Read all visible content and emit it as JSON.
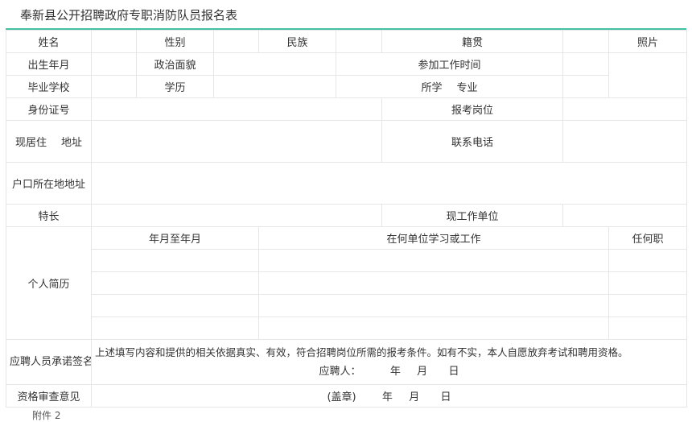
{
  "title": "奉新县公开招聘政府专职消防队员报名表",
  "accent_color": "#45c2a6",
  "row1": {
    "name": "姓名",
    "gender": "性别",
    "ethnicity": "民族",
    "native_place": "籍贯",
    "photo": "照片"
  },
  "row2": {
    "birth": "出生年月",
    "politics": "政治面貌",
    "work_start": "参加工作时间"
  },
  "row3": {
    "school": "毕业学校",
    "education": "学历",
    "major_a": "所学",
    "major_b": "专业"
  },
  "row4": {
    "id_number": "身份证号",
    "position": "报考岗位"
  },
  "row5": {
    "address_a": "现居住",
    "address_b": "地址",
    "phone": "联系电话"
  },
  "row6": {
    "hukou": "户口所在地地址"
  },
  "row7": {
    "skills": "特长",
    "current_employer": "现工作单位"
  },
  "resume": {
    "label": "个人简历",
    "col_period": "年月至年月",
    "col_unit": "在何单位学习或工作",
    "col_role": "任何职"
  },
  "pledge": {
    "label": "应聘人员承诺签名",
    "text": "上述填写内容和提供的相关依据真实、有效，符合招聘岗位所需的报考条件。如有不实，本人自愿放弃考试和聘用资格。",
    "signer": "应聘人：",
    "year": "年",
    "month": "月",
    "day": "日"
  },
  "review": {
    "label": "资格审查意见",
    "seal": "(盖章)",
    "year": "年",
    "month": "月",
    "day": "日"
  },
  "footnote": "附件 2"
}
